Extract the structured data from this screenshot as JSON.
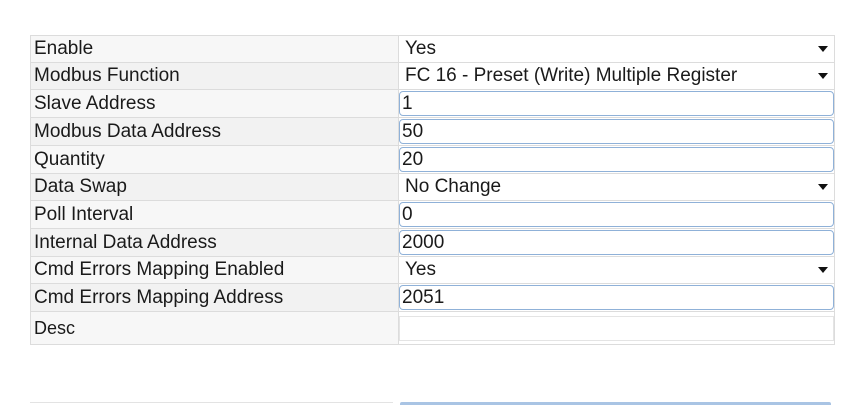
{
  "form": {
    "enable": {
      "label": "Enable",
      "value": "Yes"
    },
    "modbus_function": {
      "label": "Modbus Function",
      "value": "FC 16 - Preset (Write) Multiple Register"
    },
    "slave_address": {
      "label": "Slave Address",
      "value": "1"
    },
    "modbus_data_address": {
      "label": "Modbus Data Address",
      "value": "50"
    },
    "quantity": {
      "label": "Quantity",
      "value": "20"
    },
    "data_swap": {
      "label": "Data Swap",
      "value": "No Change"
    },
    "poll_interval": {
      "label": "Poll Interval",
      "value": "0"
    },
    "internal_data_address": {
      "label": "Internal Data Address",
      "value": "2000"
    },
    "cmd_errors_mapping_enabled": {
      "label": "Cmd Errors Mapping Enabled",
      "value": "Yes"
    },
    "cmd_errors_mapping_address": {
      "label": "Cmd Errors Mapping Address",
      "value": "2051"
    },
    "desc": {
      "label": "Desc",
      "value": ""
    }
  },
  "icons": {
    "dropdown": "chevron-down-icon"
  },
  "colors": {
    "input_border": "#8fb1d8",
    "cell_border": "#dcdcdc",
    "label_bg": "#f5f5f5"
  }
}
